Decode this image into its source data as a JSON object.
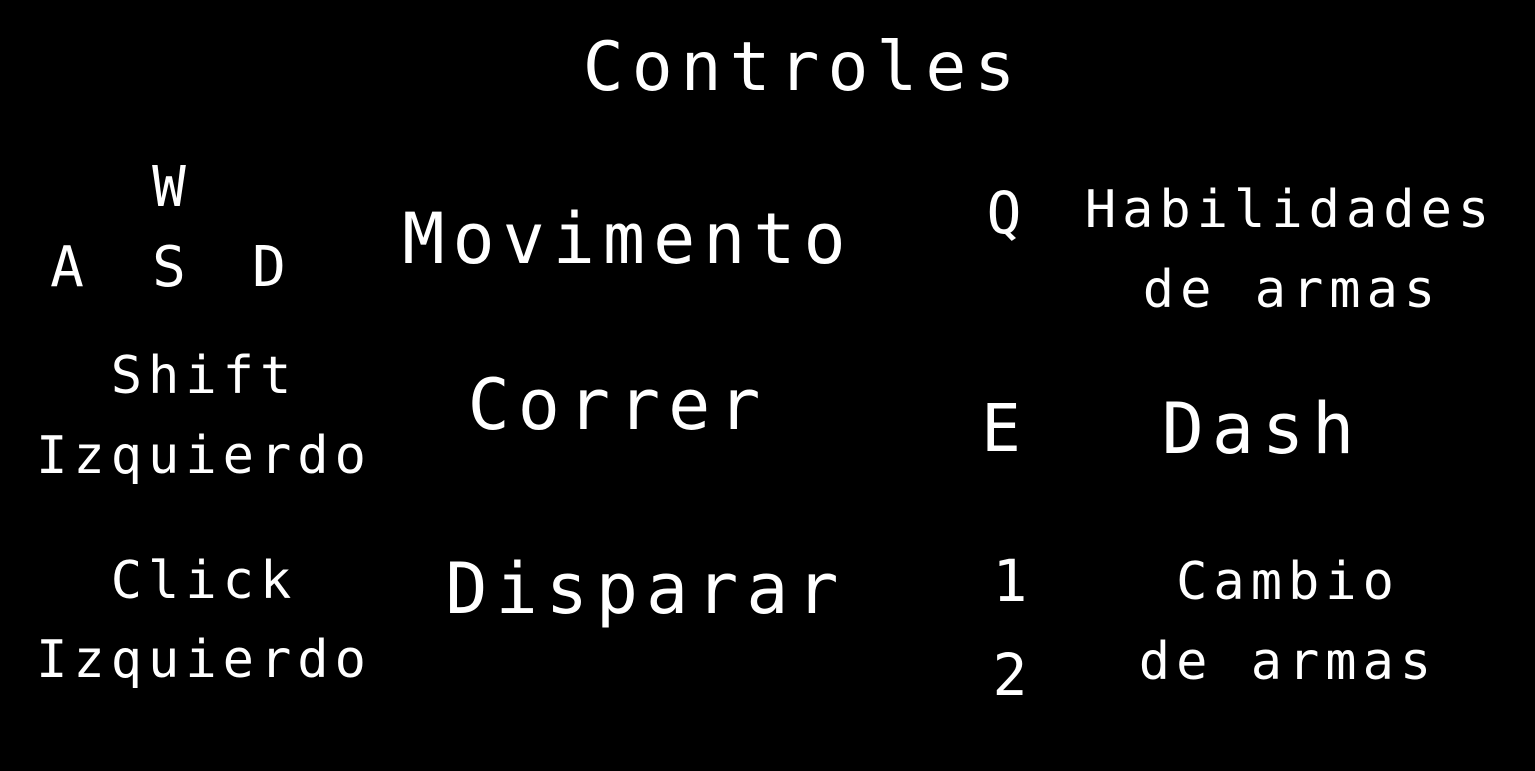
{
  "title": "Controles",
  "colors": {
    "background": "#000000",
    "text": "#ffffff"
  },
  "controls": {
    "movement": {
      "keys": {
        "w": "W",
        "a": "A",
        "s": "S",
        "d": "D"
      },
      "action": "Movimento"
    },
    "run": {
      "key_lines": [
        "Shift",
        "Izquierdo"
      ],
      "action": "Correr"
    },
    "shoot": {
      "key_lines": [
        "Click",
        "Izquierdo"
      ],
      "action": "Disparar"
    },
    "weapon_skills": {
      "key": "Q",
      "action_lines": [
        "Habilidades",
        "de armas"
      ]
    },
    "dash": {
      "key": "E",
      "action": "Dash"
    },
    "weapon_switch": {
      "keys": [
        "1",
        "2"
      ],
      "action_lines": [
        "Cambio",
        "de armas"
      ]
    }
  }
}
